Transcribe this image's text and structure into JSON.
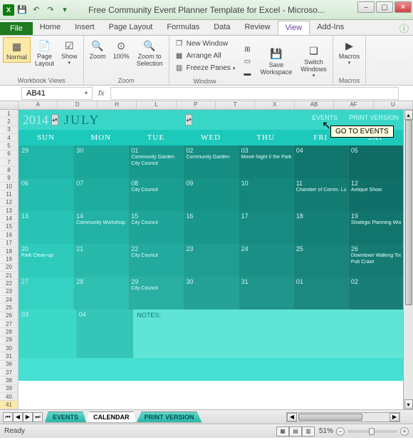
{
  "titlebar": {
    "title": "Free Community Event Planner Template for Excel - Microso..."
  },
  "tabs": {
    "file": "File",
    "items": [
      "Home",
      "Insert",
      "Page Layout",
      "Formulas",
      "Data",
      "Review",
      "View",
      "Add-Ins"
    ],
    "active": "View"
  },
  "ribbon": {
    "views": {
      "normal": "Normal",
      "pagelayout": "Page\nLayout",
      "show": "Show",
      "label": "Workbook Views"
    },
    "zoom": {
      "zoom": "Zoom",
      "hundred": "100%",
      "toselection": "Zoom to\nSelection",
      "label": "Zoom"
    },
    "window": {
      "newwin": "New Window",
      "arrange": "Arrange All",
      "freeze": "Freeze Panes",
      "save": "Save\nWorkspace",
      "switch": "Switch\nWindows",
      "label": "Window"
    },
    "macros": {
      "macros": "Macros",
      "label": "Macros"
    }
  },
  "namebox": "AB41",
  "fx": "fx",
  "colheaders": [
    "A",
    "D",
    "H",
    "L",
    "P",
    "T",
    "X",
    "AB",
    "AF",
    "U"
  ],
  "rowheaders": [
    "1",
    "2",
    "3",
    "4",
    "5",
    "6",
    "7",
    "8",
    "9",
    "10",
    "11",
    "12",
    "13",
    "14",
    "15",
    "16",
    "17",
    "18",
    "19",
    "20",
    "21",
    "22",
    "23",
    "24",
    "25",
    "26",
    "27",
    "28",
    "29",
    "30",
    "31",
    "36",
    "37",
    "38",
    "39",
    "40",
    "41"
  ],
  "calendar": {
    "year": "2014",
    "month": "JULY",
    "events_link": "EVENTS",
    "print_link": "PRINT VERSION",
    "tooltip": "GO TO EVENTS",
    "days": [
      "SUN",
      "MON",
      "TUE",
      "WED",
      "THU",
      "FRI",
      "SAT"
    ],
    "weeks": [
      [
        {
          "n": "29",
          "c": "#1fb5a8"
        },
        {
          "n": "30",
          "c": "#1aa699"
        },
        {
          "n": "01",
          "c": "#17998d",
          "ev": [
            "Community Garden",
            "City Council"
          ]
        },
        {
          "n": "02",
          "c": "#158d82",
          "ev": [
            "Community Garden"
          ]
        },
        {
          "n": "03",
          "c": "#138178",
          "ev": [
            "Movie Night I/ the Park"
          ]
        },
        {
          "n": "04",
          "c": "#11766e"
        },
        {
          "n": "05",
          "c": "#0f6b64"
        }
      ],
      [
        {
          "n": "06",
          "c": "#23bcae"
        },
        {
          "n": "07",
          "c": "#1eac9f"
        },
        {
          "n": "08",
          "c": "#1a9e92",
          "ev": [
            "City Council"
          ]
        },
        {
          "n": "09",
          "c": "#179287"
        },
        {
          "n": "10",
          "c": "#14867c"
        },
        {
          "n": "11",
          "c": "#127b72",
          "ev": [
            "Chamber of Comm. Luncheon"
          ]
        },
        {
          "n": "12",
          "c": "#107069",
          "ev": [
            "Antique Show"
          ]
        }
      ],
      [
        {
          "n": "13",
          "c": "#28c3b5"
        },
        {
          "n": "14",
          "c": "#22b2a5",
          "ev": [
            "Community Workshop"
          ]
        },
        {
          "n": "15",
          "c": "#1ea498",
          "ev": [
            "City Council"
          ]
        },
        {
          "n": "16",
          "c": "#1a978c"
        },
        {
          "n": "17",
          "c": "#178b81"
        },
        {
          "n": "18",
          "c": "#148077"
        },
        {
          "n": "19",
          "c": "#12756d",
          "ev": [
            "Strategic Planning Workshop"
          ]
        }
      ],
      [
        {
          "n": "20",
          "c": "#2ecabb",
          "ev": [
            "Park Clean-up"
          ]
        },
        {
          "n": "21",
          "c": "#28b9ab"
        },
        {
          "n": "22",
          "c": "#23aa9e",
          "ev": [
            "City Council"
          ]
        },
        {
          "n": "23",
          "c": "#1f9d92"
        },
        {
          "n": "24",
          "c": "#1b9086"
        },
        {
          "n": "25",
          "c": "#18857c"
        },
        {
          "n": "26",
          "c": "#157a72",
          "ev": [
            "Downtown Walking Tour",
            "Pub Crawl"
          ]
        }
      ],
      [
        {
          "n": "27",
          "c": "#35d1c2"
        },
        {
          "n": "28",
          "c": "#2ebfb1"
        },
        {
          "n": "29",
          "c": "#29b0a3",
          "ev": [
            "City Council"
          ]
        },
        {
          "n": "30",
          "c": "#24a297"
        },
        {
          "n": "31",
          "c": "#20958b"
        },
        {
          "n": "01",
          "c": "#1c8981"
        },
        {
          "n": "02",
          "c": "#197e77"
        }
      ]
    ],
    "extra_row": [
      {
        "n": "03",
        "c": "#3cd8c8"
      },
      {
        "n": "04",
        "c": "#35c6b8"
      }
    ],
    "notes_label": "NOTES:"
  },
  "sheettabs": {
    "items": [
      "EVENTS",
      "CALENDAR",
      "PRINT VERSION"
    ],
    "active": "CALENDAR"
  },
  "status": {
    "ready": "Ready",
    "zoom": "51%"
  }
}
